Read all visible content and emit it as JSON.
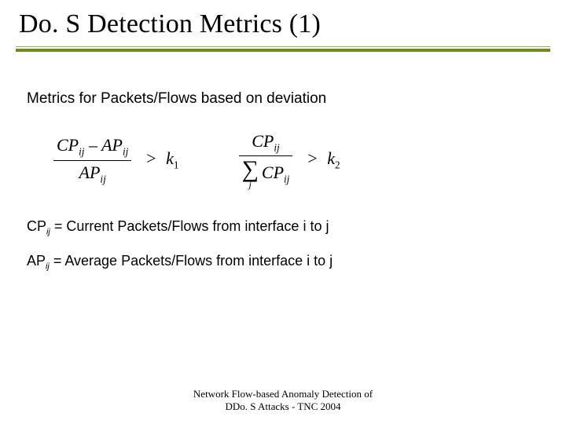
{
  "title": "Do. S Detection Metrics (1)",
  "body_heading": "Metrics for Packets/Flows based on deviation",
  "formula1": {
    "num_a": "CP",
    "num_a_sub": "ij",
    "num_op": "–",
    "num_b": "AP",
    "num_b_sub": "ij",
    "den": "AP",
    "den_sub": "ij",
    "rel": ">",
    "k": "k",
    "k_sub": "1"
  },
  "formula2": {
    "num": "CP",
    "num_sub": "ij",
    "sigma": "∑",
    "sigma_sub": "j",
    "den": "CP",
    "den_sub": "ij",
    "rel": ">",
    "k": "k",
    "k_sub": "2"
  },
  "def1": {
    "var": "CP",
    "var_sub": "ij",
    "text": " = Current Packets/Flows from interface i to j"
  },
  "def2": {
    "var": "AP",
    "var_sub": "ij",
    "text": " = Average Packets/Flows from interface i to j"
  },
  "footer_line1": "Network Flow-based Anomaly Detection of",
  "footer_line2": "DDo. S Attacks - TNC 2004"
}
